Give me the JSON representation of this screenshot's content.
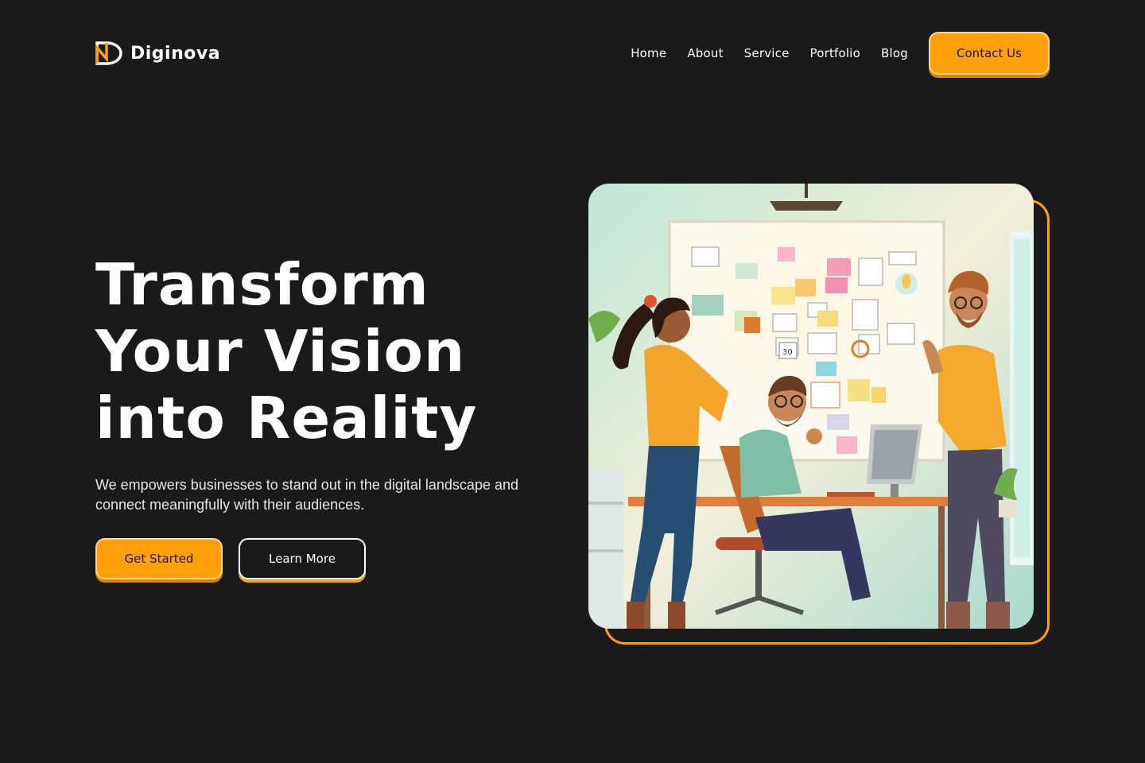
{
  "brand": {
    "name": "Diginova",
    "logo_icon": "dn-monogram-icon",
    "accent": "#ff9f0a",
    "background": "#1a1a1a"
  },
  "nav": {
    "links": [
      "Home",
      "About",
      "Service",
      "Portfolio",
      "Blog"
    ],
    "contact_label": "Contact Us"
  },
  "hero": {
    "title_lines": [
      "Transform",
      "Your Vision",
      "into Reality"
    ],
    "description": "We empowers businesses to stand out in the digital landscape and connect meaningfully with their audiences.",
    "primary_cta": "Get Started",
    "secondary_cta": "Learn More"
  },
  "illustration": {
    "subject": "team-brainstorming-office-illustration",
    "sticky_note_text": "30"
  }
}
